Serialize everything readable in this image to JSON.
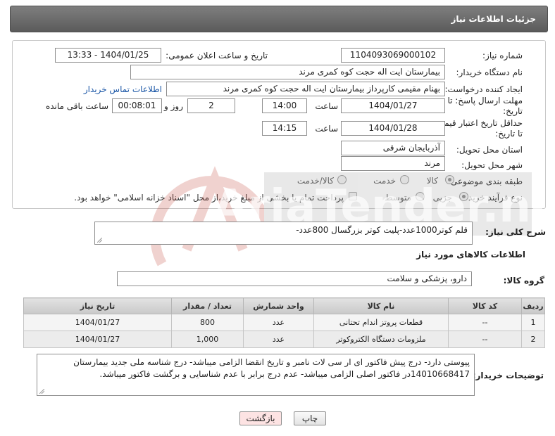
{
  "header": {
    "title": "جزئیات اطلاعات نیاز"
  },
  "form": {
    "need_number_label": "شماره نیاز:",
    "need_number": "1104093069000102",
    "announce_label": "تاریخ و ساعت اعلان عمومی:",
    "announce_value": "1404/01/25 - 13:33",
    "buyer_label": "نام دستگاه خریدار:",
    "buyer_value": "بیمارستان ایت اله حجت کوه کمری مرند",
    "creator_label": "ایجاد کننده درخواست:",
    "creator_value": "بهنام مقیمی کارپرداز بیمارستان ایت اله حجت کوه کمری مرند",
    "contact_link": "اطلاعات تماس خریدار",
    "deadline_label_line1": "مهلت ارسال پاسخ: تا",
    "deadline_label_line2": "تاریخ:",
    "deadline_date": "1404/01/27",
    "time_label": "ساعت",
    "deadline_time": "14:00",
    "days_value": "2",
    "days_label": "روز و",
    "remaining_value": "00:08:01",
    "remaining_label": "ساعت باقی مانده",
    "validity_label_line1": "حداقل تاریخ اعتبار قیمت:",
    "validity_label_line2": "تا تاریخ:",
    "validity_date": "1404/01/28",
    "validity_time_label": "ساعت",
    "validity_time": "14:15",
    "province_label": "استان محل تحویل:",
    "province_value": "آذربایجان شرقی",
    "city_label": "شهر محل تحویل:",
    "city_value": "مرند",
    "category_label": "طبقه بندی موضوعی:",
    "category_options": [
      "کالا",
      "خدمت",
      "کالا/خدمت"
    ],
    "process_label": "نوع فرآیند خرید :",
    "process_options": [
      "جزیی",
      "متوسط"
    ],
    "payment_note": "پرداخت تمام یا بخشی از مبلغ خرید،از محل \"اسناد خزانه اسلامی\" خواهد بود."
  },
  "summary": {
    "label": "شرح کلی نیاز:",
    "value": "قلم کوتر1000عدد-پلیت کوتر بزرگسال 800عدد-"
  },
  "goods": {
    "section_title": "اطلاعات کالاهای مورد نیاز",
    "group_label": "گروه کالا:",
    "group_value": "دارو، پزشکی و سلامت",
    "columns": [
      "ردیف",
      "کد کالا",
      "نام کالا",
      "واحد شمارش",
      "تعداد / مقدار",
      "تاریخ نیاز"
    ],
    "rows": [
      {
        "row": "1",
        "code": "--",
        "name": "قطعات پروتز اندام تحتانی",
        "unit": "عدد",
        "qty": "800",
        "date": "1404/01/27"
      },
      {
        "row": "2",
        "code": "--",
        "name": "ملزومات دستگاه الکتروکوتر",
        "unit": "عدد",
        "qty": "1,000",
        "date": "1404/01/27"
      }
    ]
  },
  "buyer_notes": {
    "label": "توضیحات خریدار:",
    "value": "پیوستی دارد- درج پیش فاکتور ای ار سی لات نامبر و تاریخ انقضا الزامی میباشد- درج شناسه ملی  جدید بیمارستان 14010668417در فاکتور اصلی الزامی میباشد- عدم درج برابر با عدم شناسایی و برگشت فاکتور میباشد."
  },
  "buttons": {
    "print": "چاپ",
    "back": "بازگشت"
  },
  "watermark": {
    "text": "AriaTender.net"
  },
  "colors": {
    "header_bg": "#6b6b6b",
    "link": "#1a56a6",
    "back_button_bg": "#fde3e3"
  }
}
